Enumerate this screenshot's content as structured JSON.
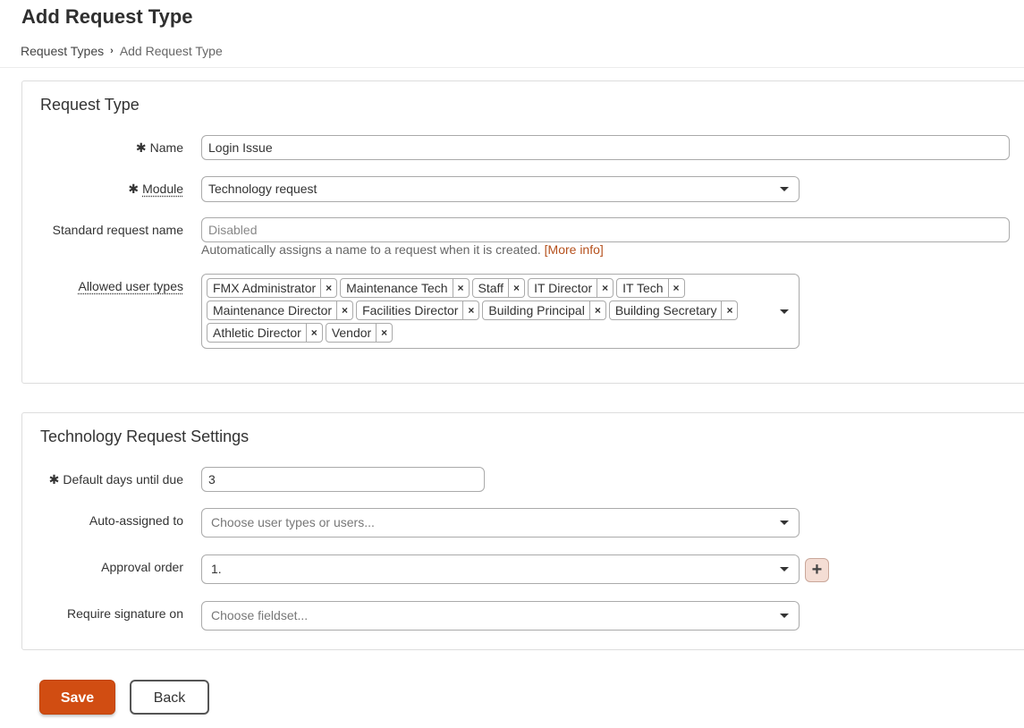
{
  "page": {
    "title": "Add Request Type"
  },
  "breadcrumb": {
    "parent": "Request Types",
    "separator": "›",
    "current": "Add Request Type"
  },
  "request_type": {
    "section_title": "Request Type",
    "name": {
      "label": "Name",
      "required": "✱",
      "value": "Login Issue"
    },
    "module": {
      "label": "Module",
      "required": "✱",
      "value": "Technology request"
    },
    "standard_name": {
      "label": "Standard request name",
      "placeholder": "Disabled",
      "help": "Automatically assigns a name to a request when it is created.",
      "help_link": "[More info]"
    },
    "allowed_user_types": {
      "label": "Allowed user types",
      "remove_glyph": "×",
      "tags": [
        "FMX Administrator",
        "Maintenance Tech",
        "Staff",
        "IT Director",
        "IT Tech",
        "Maintenance Director",
        "Facilities Director",
        "Building Principal",
        "Building Secretary",
        "Athletic Director",
        "Vendor"
      ]
    }
  },
  "tech_settings": {
    "section_title": "Technology Request Settings",
    "default_days": {
      "label": "Default days until due",
      "required": "✱",
      "value": "3"
    },
    "auto_assigned": {
      "label": "Auto-assigned to",
      "placeholder": "Choose user types or users..."
    },
    "approval_order": {
      "label": "Approval order",
      "value": "1.",
      "add_glyph": "+"
    },
    "require_signature": {
      "label": "Require signature on",
      "placeholder": "Choose fieldset..."
    }
  },
  "actions": {
    "save_label": "Save",
    "back_label": "Back"
  },
  "colors": {
    "accent": "#d14d12",
    "link": "#b5501c"
  }
}
